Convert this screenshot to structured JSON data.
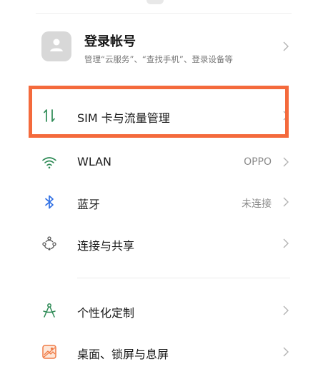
{
  "account": {
    "title": "登录帐号",
    "subtitle": "管理“云服务”、“查找手机”、登录设备等"
  },
  "rows": [
    {
      "label": "SIM 卡与流量管理",
      "value": "",
      "icon": "sim-data-icon"
    },
    {
      "label": "WLAN",
      "value": "OPPO",
      "icon": "wifi-icon"
    },
    {
      "label": "蓝牙",
      "value": "未连接",
      "icon": "bluetooth-icon"
    },
    {
      "label": "连接与共享",
      "value": "",
      "icon": "connection-sharing-icon"
    },
    {
      "label": "个性化定制",
      "value": "",
      "icon": "personalization-icon"
    },
    {
      "label": "桌面、锁屏与息屏",
      "value": "",
      "icon": "wallpaper-icon"
    }
  ],
  "colors": {
    "accent": "#2d8a55",
    "blue": "#2f6fe4",
    "highlight": "#f46a3c"
  }
}
